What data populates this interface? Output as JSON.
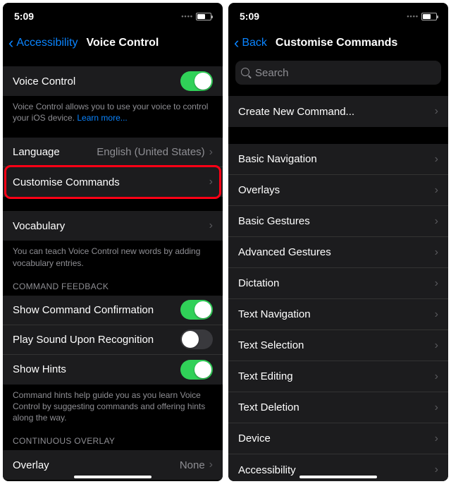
{
  "left": {
    "time": "5:09",
    "back": "Accessibility",
    "title": "Voice Control",
    "voice_control_label": "Voice Control",
    "voice_control_desc_a": "Voice Control allows you to use your voice to control your iOS device. ",
    "voice_control_desc_link": "Learn more...",
    "language_label": "Language",
    "language_value": "English (United States)",
    "customise_label": "Customise Commands",
    "vocabulary_label": "Vocabulary",
    "vocabulary_desc": "You can teach Voice Control new words by adding vocabulary entries.",
    "feedback_header": "COMMAND FEEDBACK",
    "confirm_label": "Show Command Confirmation",
    "sound_label": "Play Sound Upon Recognition",
    "hints_label": "Show Hints",
    "hints_desc": "Command hints help guide you as you learn Voice Control by suggesting commands and offering hints along the way.",
    "overlay_header": "CONTINUOUS OVERLAY",
    "overlay_label": "Overlay",
    "overlay_value": "None"
  },
  "right": {
    "time": "5:09",
    "back": "Back",
    "title": "Customise Commands",
    "search_placeholder": "Search",
    "create_label": "Create New Command...",
    "categories": [
      "Basic Navigation",
      "Overlays",
      "Basic Gestures",
      "Advanced Gestures",
      "Dictation",
      "Text Navigation",
      "Text Selection",
      "Text Editing",
      "Text Deletion",
      "Device",
      "Accessibility"
    ]
  }
}
